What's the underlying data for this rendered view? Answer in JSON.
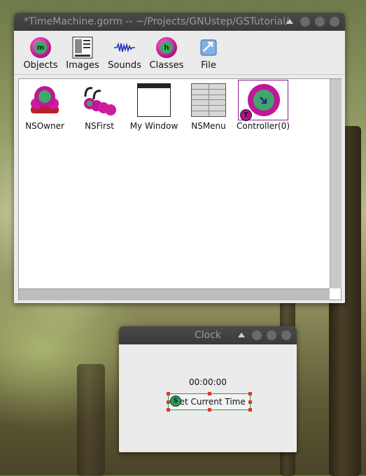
{
  "gorm_window": {
    "title": "*TimeMachine.gorm  --  ~/Projects/GNUstep/GSTutorial/:",
    "toolbar": [
      {
        "label": "Objects",
        "icon": "objects-icon"
      },
      {
        "label": "Images",
        "icon": "images-icon"
      },
      {
        "label": "Sounds",
        "icon": "sounds-icon"
      },
      {
        "label": "Classes",
        "icon": "classes-icon"
      },
      {
        "label": "File",
        "icon": "file-icon"
      }
    ],
    "objects": [
      {
        "label": "NSOwner",
        "icon": "nsowner-icon"
      },
      {
        "label": "NSFirst",
        "icon": "nsfirst-icon"
      },
      {
        "label": "My Window",
        "icon": "window-icon"
      },
      {
        "label": "NSMenu",
        "icon": "menu-icon"
      },
      {
        "label": "Controller(0)",
        "icon": "controller-icon",
        "badge": "T"
      }
    ],
    "orb_letters": {
      "objects": "m",
      "classes": "h"
    }
  },
  "clock_window": {
    "title": "Clock",
    "time_label": "00:00:00",
    "button_label": "Get Current Time",
    "button_badge": "S"
  },
  "colors": {
    "selection_border": "#2aa52a",
    "handle": "#d93a2a",
    "orb": "#c1169a"
  }
}
